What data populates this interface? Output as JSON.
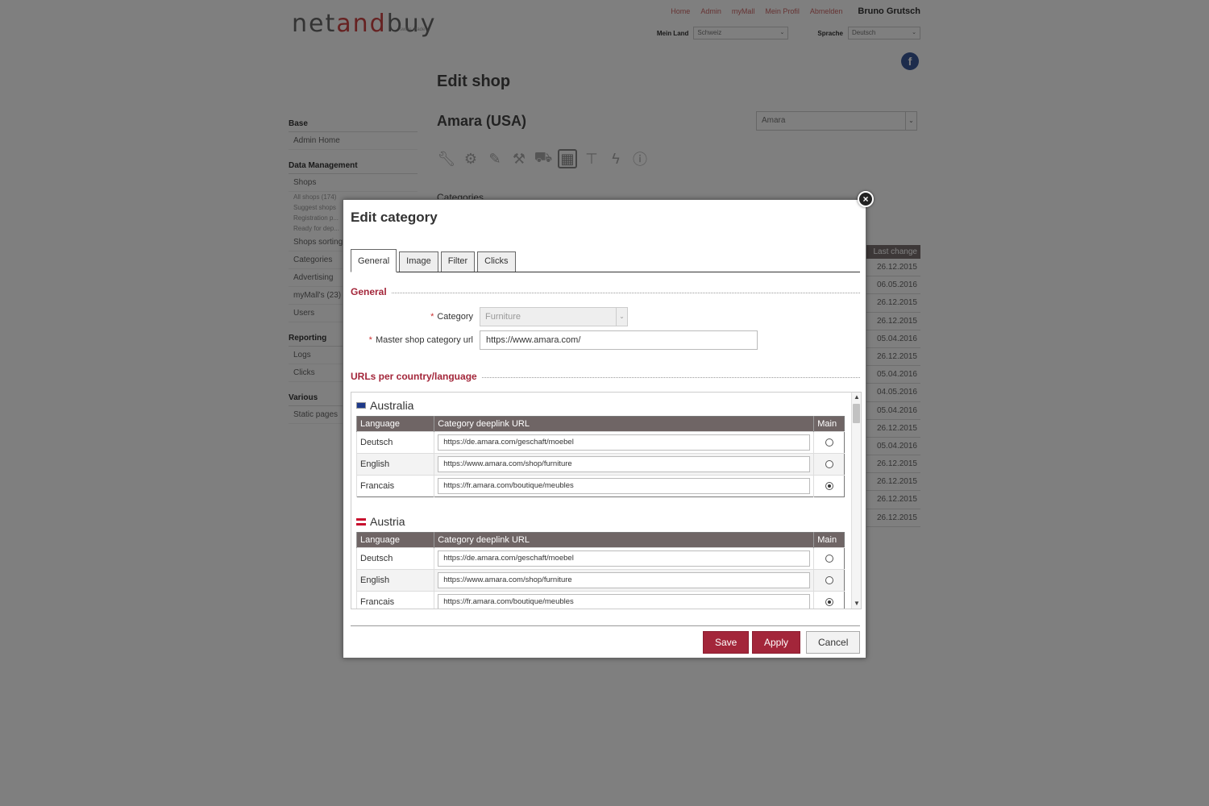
{
  "header": {
    "logo_a": "net",
    "logo_b": "and",
    "logo_c": "buy",
    "logo_sub": "swiss made",
    "nav": [
      "Home",
      "Admin",
      "myMall",
      "Mein Profil",
      "Abmelden"
    ],
    "user": "Bruno Grutsch",
    "country_label": "Mein Land",
    "country_value": "Schweiz",
    "language_label": "Sprache",
    "language_value": "Deutsch",
    "facebook_letter": "f"
  },
  "sidebar": {
    "sections": [
      {
        "title": "Base",
        "items": [
          "Admin Home"
        ]
      },
      {
        "title": "Data Management",
        "items": [
          "Shops"
        ],
        "sub": [
          "All shops (174)",
          "Suggest shops",
          "Registration p...",
          "Ready for dep..."
        ],
        "more": [
          "Shops sorting",
          "Categories",
          "Advertising",
          "myMall's (23)",
          "Users"
        ]
      },
      {
        "title": "Reporting",
        "items": [
          "Logs",
          "Clicks"
        ]
      },
      {
        "title": "Various",
        "items": [
          "Static pages"
        ]
      }
    ]
  },
  "main": {
    "title": "Edit shop",
    "shop_name": "Amara (USA)",
    "shop_select": "Amara",
    "section": "Categories",
    "dates_header": "Last change",
    "dates": [
      "26.12.2015",
      "06.05.2016",
      "26.12.2015",
      "26.12.2015",
      "05.04.2016",
      "26.12.2015",
      "05.04.2016",
      "04.05.2016",
      "05.04.2016",
      "26.12.2015",
      "05.04.2016",
      "26.12.2015",
      "26.12.2015",
      "26.12.2015",
      "26.12.2015"
    ]
  },
  "modal": {
    "title": "Edit category",
    "close": "×",
    "tabs": [
      "General",
      "Image",
      "Filter",
      "Clicks"
    ],
    "general_legend": "General",
    "category_label": "Category",
    "category_value": "Furniture",
    "master_url_label": "Master shop category url",
    "master_url_value": "https://www.amara.com/",
    "urls_legend": "URLs per country/language",
    "table_headers": [
      "Language",
      "Category deeplink URL",
      "Main"
    ],
    "countries": [
      {
        "name": "Australia",
        "rows": [
          {
            "lang": "Deutsch",
            "url": "https://de.amara.com/geschaft/moebel",
            "main": false
          },
          {
            "lang": "English",
            "url": "https://www.amara.com/shop/furniture",
            "main": false
          },
          {
            "lang": "Francais",
            "url": "https://fr.amara.com/boutique/meubles",
            "main": true
          }
        ]
      },
      {
        "name": "Austria",
        "rows": [
          {
            "lang": "Deutsch",
            "url": "https://de.amara.com/geschaft/moebel",
            "main": false
          },
          {
            "lang": "English",
            "url": "https://www.amara.com/shop/furniture",
            "main": false
          },
          {
            "lang": "Francais",
            "url": "https://fr.amara.com/boutique/meubles",
            "main": true
          }
        ]
      }
    ],
    "save": "Save",
    "apply": "Apply",
    "cancel": "Cancel"
  },
  "colors": {
    "accent": "#a3263a",
    "table_header": "#6f6565",
    "overlay": "#808080"
  }
}
